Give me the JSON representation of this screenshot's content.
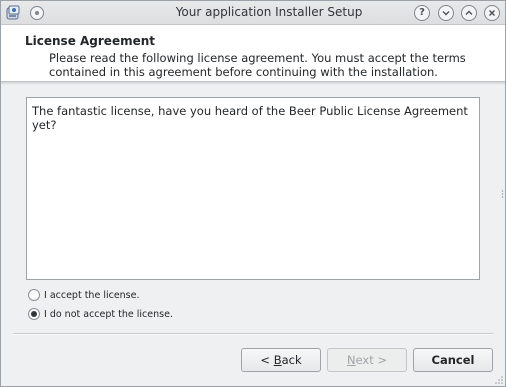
{
  "window": {
    "title": "Your application Installer Setup"
  },
  "titlebar": {
    "help_label": "?",
    "min_label": "⌄",
    "max_label": "⌃",
    "close_label": "✕"
  },
  "header": {
    "title": "License Agreement",
    "description": "Please read the following license agreement. You must accept the terms contained in this agreement before continuing with the installation."
  },
  "license": {
    "text": "The fantastic license, have you heard of the Beer Public License Agreement yet?"
  },
  "options": {
    "accept_label": "I accept the license.",
    "decline_label": "I do not accept the license.",
    "selected": "decline"
  },
  "buttons": {
    "back_prefix": "< ",
    "back_mnemonic": "B",
    "back_rest": "ack",
    "next_mnemonic": "N",
    "next_rest": "ext >",
    "cancel_label": "Cancel"
  },
  "colors": {
    "window_bg": "#eff0f1",
    "panel_bg": "#ffffff",
    "text": "#232629",
    "disabled_text": "#a1a4a7"
  },
  "icons": {
    "app": "installer-app-icon",
    "pin": "pin-icon",
    "help": "help-icon",
    "minimize": "minimize-icon",
    "maximize": "maximize-icon",
    "close": "close-icon"
  }
}
